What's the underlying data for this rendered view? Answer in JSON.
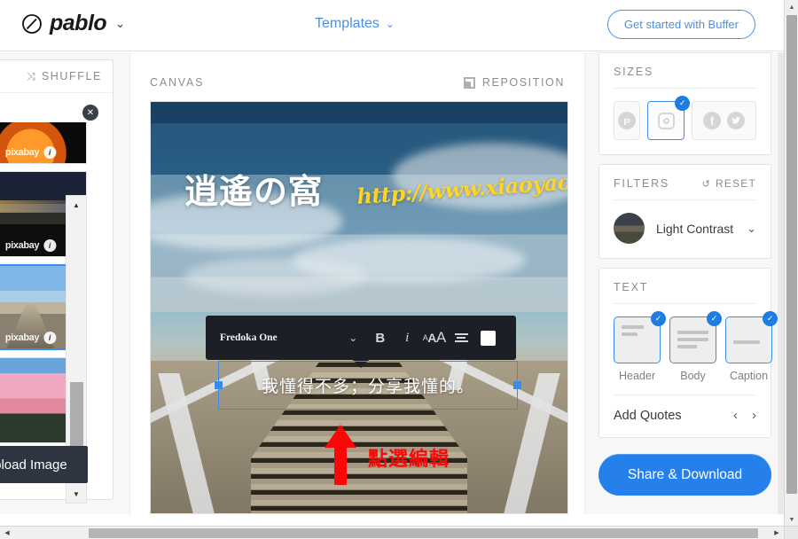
{
  "topbar": {
    "brand_name": "pablo",
    "brand_icon": "pablo-logo-icon",
    "brand_caret": "⌄",
    "templates_label": "Templates",
    "templates_caret": "⌄",
    "get_started_label": "Get started with Buffer"
  },
  "left_panel": {
    "shuffle_label": "SHUFFLE",
    "shuffle_icon": "⤨",
    "close_icon": "✕",
    "upload_label": "Upload Image",
    "watermark_text": "pixabay",
    "watermark_info": "i",
    "check_glyph": "✓",
    "scroll_up": "▲",
    "scroll_down": "▼",
    "thumbnails": [
      {
        "name": "blood-moon",
        "selected": false,
        "art": "art-moon"
      },
      {
        "name": "night-coast",
        "selected": false,
        "art": "art-night"
      },
      {
        "name": "wooden-pier",
        "selected": true,
        "art": "art-pier"
      },
      {
        "name": "pink-sunset",
        "selected": false,
        "art": "art-pink"
      }
    ]
  },
  "canvas": {
    "label": "CANVAS",
    "reposition_label": "REPOSITION",
    "headline": "逍遙の窩",
    "url_text": "http://www.xiaoyao.tw/",
    "body_text": "我懂得不多；分享我懂的。",
    "annotation_text": "點選編輯",
    "annotation_color": "#fa0808",
    "toolbar": {
      "font_name": "Fredoka One",
      "caret": "⌄",
      "bold_label": "B",
      "italic_label": "i",
      "size_small": "A",
      "size_mid": "A",
      "size_large": "A",
      "align_name": "align-center-icon",
      "color_swatch": "#ffffff"
    }
  },
  "right_panel": {
    "sizes": {
      "title": "SIZES",
      "options": [
        {
          "name": "pinterest",
          "glyph": "ᴘ",
          "selected": false
        },
        {
          "name": "instagram",
          "glyph": "",
          "selected": true
        },
        {
          "name": "facebook-twitter",
          "glyph": "",
          "selected": false
        }
      ],
      "facebook_glyph": "f",
      "twitter_glyph": "ᴛ",
      "check_glyph": "✓"
    },
    "filters": {
      "title": "FILTERS",
      "reset_label": "RESET",
      "reset_icon": "↺",
      "selected_filter": "Light Contrast",
      "caret": "⌄"
    },
    "text": {
      "title": "TEXT",
      "options": [
        {
          "label": "Header",
          "selected": true
        },
        {
          "label": "Body",
          "selected": true
        },
        {
          "label": "Caption",
          "selected": true
        }
      ],
      "check_glyph": "✓",
      "quotes_label": "Add Quotes",
      "prev_glyph": "‹",
      "next_glyph": "›"
    },
    "share_label": "Share & Download"
  },
  "scrollbars": {
    "up_arrow": "▲",
    "down_arrow": "▼",
    "left_arrow": "◀",
    "right_arrow": "▶"
  },
  "colors": {
    "accent_blue": "#3b8ce8",
    "button_blue": "#2680eb",
    "link_blue": "#4a90e2",
    "annotation_red": "#fa0808",
    "url_yellow": "#ffd426",
    "toolbar_dark": "#1c1f26"
  }
}
